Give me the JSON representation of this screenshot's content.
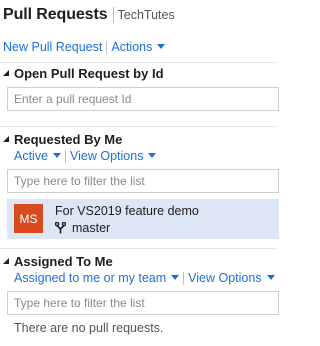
{
  "header": {
    "title": "Pull Requests",
    "project": "TechTutes"
  },
  "toolbar": {
    "new_pr_label": "New Pull Request",
    "actions_label": "Actions"
  },
  "open_by_id": {
    "heading": "Open Pull Request by Id",
    "placeholder": "Enter a pull request Id"
  },
  "requested_by_me": {
    "heading": "Requested By Me",
    "status_filter": "Active",
    "view_options_label": "View Options",
    "filter_placeholder": "Type here to filter the list",
    "items": [
      {
        "avatar_initials": "MS",
        "avatar_color": "#d84b1e",
        "title": "For VS2019 feature demo",
        "branch": "master"
      }
    ]
  },
  "assigned_to_me": {
    "heading": "Assigned To Me",
    "scope_filter": "Assigned to me or my team",
    "view_options_label": "View Options",
    "filter_placeholder": "Type here to filter the list",
    "empty_text": "There are no pull requests."
  },
  "colors": {
    "link": "#1e6fd9",
    "selected_row": "#dde6f5",
    "avatar": "#d84b1e"
  }
}
